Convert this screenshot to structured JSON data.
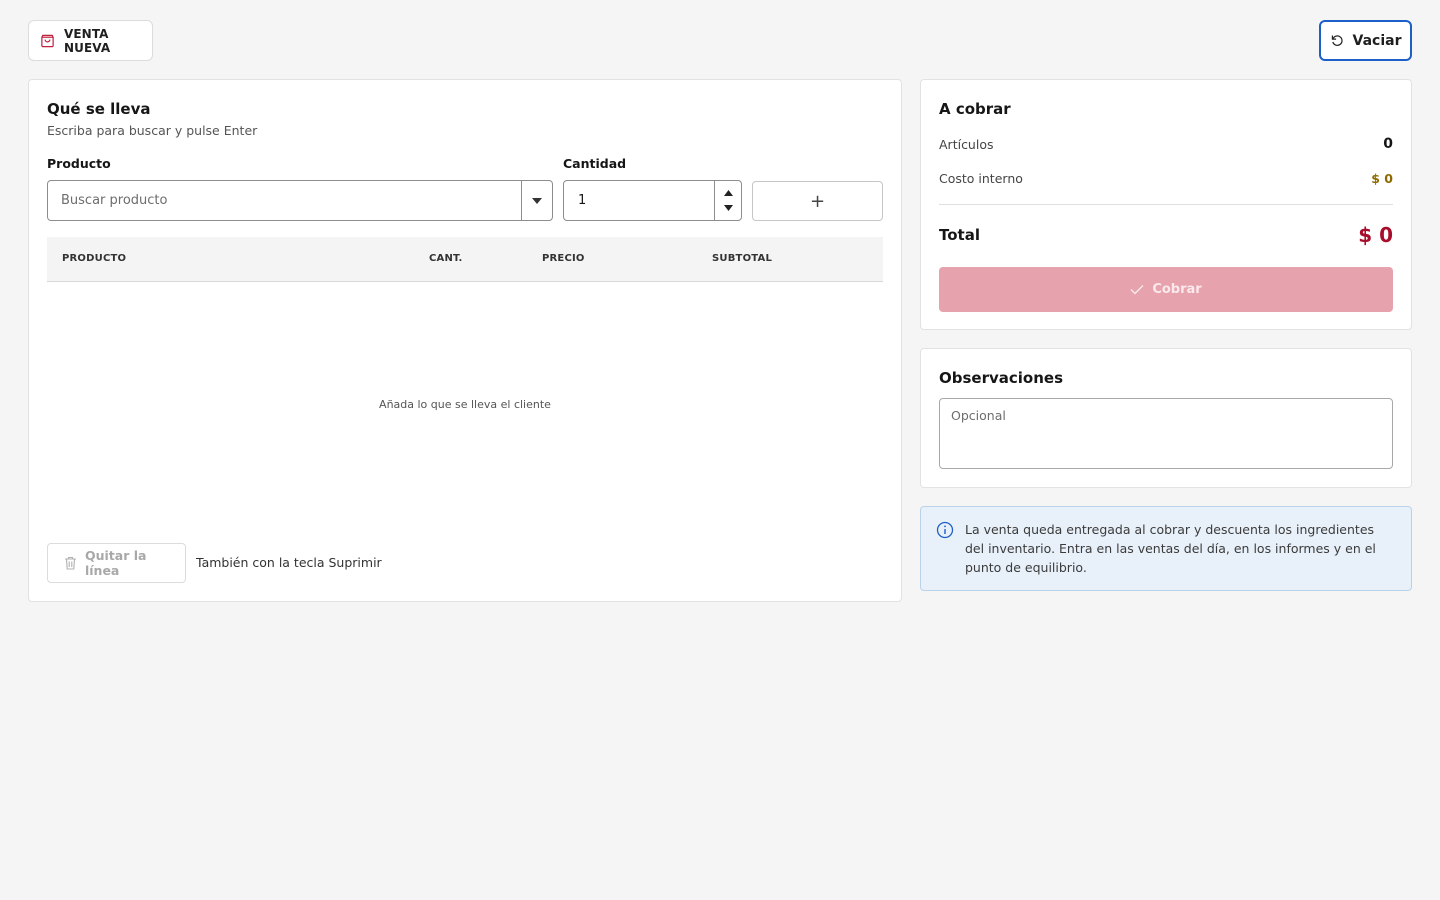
{
  "header": {
    "badge_label": "VENTA NUEVA",
    "clear_label": "Vaciar"
  },
  "items_panel": {
    "title": "Qué se lleva",
    "subtitle": "Escriba para buscar y pulse Enter",
    "product_label": "Producto",
    "product_placeholder": "Buscar producto",
    "quantity_label": "Cantidad",
    "quantity_value": "1",
    "add_label": "+",
    "table": {
      "columns": [
        "PRODUCTO",
        "CANT.",
        "PRECIO",
        "SUBTOTAL"
      ],
      "rows": [],
      "empty_message": "Añada lo que se lleva el cliente"
    },
    "remove_label": "Quitar la línea",
    "remove_hint": "También con la tecla Suprimir"
  },
  "summary": {
    "title": "A cobrar",
    "items_label": "Artículos",
    "items_value": "0",
    "cost_label": "Costo interno",
    "cost_value": "$ 0",
    "total_label": "Total",
    "total_value": "$ 0",
    "charge_label": "Cobrar"
  },
  "notes": {
    "title": "Observaciones",
    "placeholder": "Opcional"
  },
  "info": {
    "text": "La venta queda entregada al cobrar y descuenta los ingredientes del inventario. Entra en las ventas del día, en los informes y en el punto de equilibrio."
  },
  "colors": {
    "accent_blue": "#1d5fc9",
    "brand_red": "#a80e2c",
    "cost_gold": "#8e6a00",
    "charge_disabled": "#e6a3ae",
    "info_bg": "#e8f1fa"
  },
  "icons": {
    "badge": "shopping-bag-icon",
    "clear": "reset-icon",
    "select": "caret-down-icon",
    "spinner_up": "triangle-up-icon",
    "spinner_down": "triangle-down-icon",
    "remove": "trash-icon",
    "charge": "checkmark-icon",
    "info": "info-icon"
  }
}
